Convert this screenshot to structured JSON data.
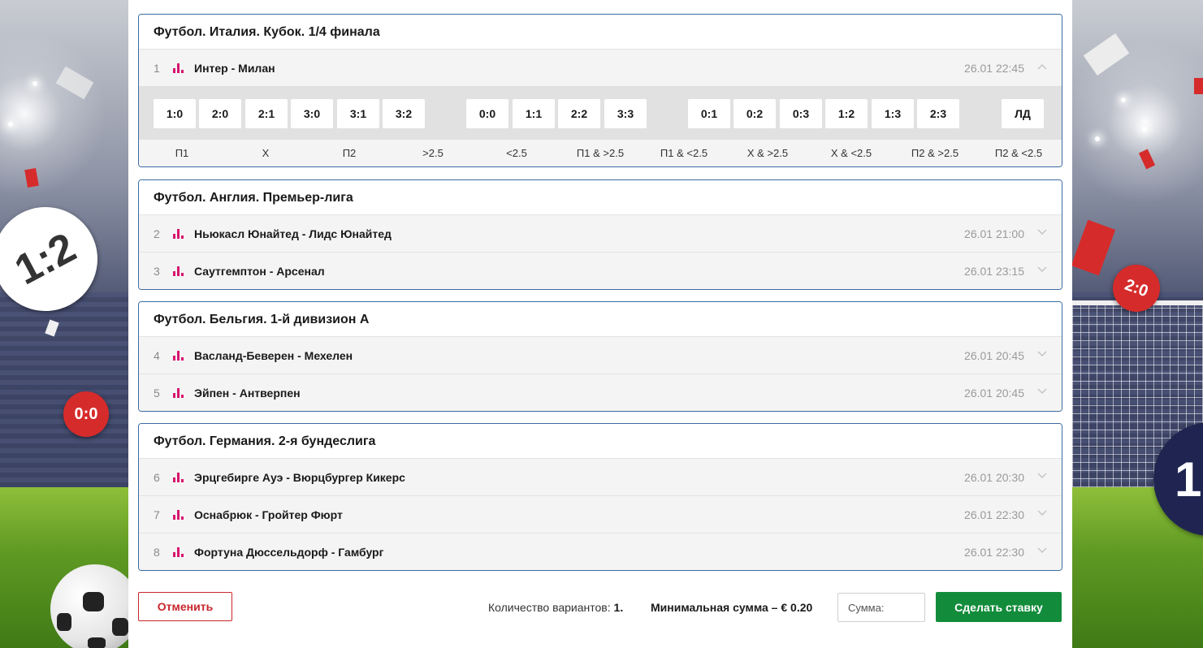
{
  "colors": {
    "accent_border": "#3c6ba5",
    "stat_icon": "#d8146e",
    "cancel": "#c8262b",
    "bet_button": "#128c3b"
  },
  "decor": {
    "left_badges": [
      "1:2",
      "0:0"
    ],
    "right_badges": [
      "2:0",
      "1"
    ]
  },
  "groups": [
    {
      "title": "Футбол. Италия. Кубок. 1/4 финала",
      "matches": [
        {
          "num": "1",
          "name": "Интер - Милан",
          "time": "26.01 22:45",
          "expanded": true
        }
      ],
      "odds": [
        "1:0",
        "2:0",
        "2:1",
        "3:0",
        "3:1",
        "3:2",
        "0:0",
        "1:1",
        "2:2",
        "3:3",
        "0:1",
        "0:2",
        "0:3",
        "1:2",
        "1:3",
        "2:3",
        "ЛД"
      ],
      "labels": [
        "П1",
        "X",
        "П2",
        ">2.5",
        "<2.5",
        "П1 & >2.5",
        "П1 & <2.5",
        "X & >2.5",
        "X & <2.5",
        "П2 & >2.5",
        "П2 & <2.5"
      ]
    },
    {
      "title": "Футбол. Англия. Премьер-лига",
      "matches": [
        {
          "num": "2",
          "name": "Ньюкасл Юнайтед - Лидс Юнайтед",
          "time": "26.01 21:00",
          "expanded": false
        },
        {
          "num": "3",
          "name": "Саутгемптон - Арсенал",
          "time": "26.01 23:15",
          "expanded": false
        }
      ]
    },
    {
      "title": "Футбол. Бельгия. 1-й дивизион А",
      "matches": [
        {
          "num": "4",
          "name": "Васланд-Беверен - Мехелен",
          "time": "26.01 20:45",
          "expanded": false
        },
        {
          "num": "5",
          "name": "Эйпен - Антверпен",
          "time": "26.01 20:45",
          "expanded": false
        }
      ]
    },
    {
      "title": "Футбол. Германия. 2-я бундеслига",
      "matches": [
        {
          "num": "6",
          "name": "Эрцгебирге Ауэ - Вюрцбургер Кикерс",
          "time": "26.01 20:30",
          "expanded": false
        },
        {
          "num": "7",
          "name": "Оснабрюк - Гройтер Фюрт",
          "time": "26.01 22:30",
          "expanded": false
        },
        {
          "num": "8",
          "name": "Фортуна Дюссельдорф - Гамбург",
          "time": "26.01 22:30",
          "expanded": false
        }
      ]
    }
  ],
  "footer": {
    "cancel_label": "Отменить",
    "variants_label": "Количество вариантов: ",
    "variants_count": "1.",
    "min_sum_label": "Минимальная сумма – € 0.20",
    "sum_placeholder": "Сумма:",
    "bet_label": "Сделать ставку"
  }
}
